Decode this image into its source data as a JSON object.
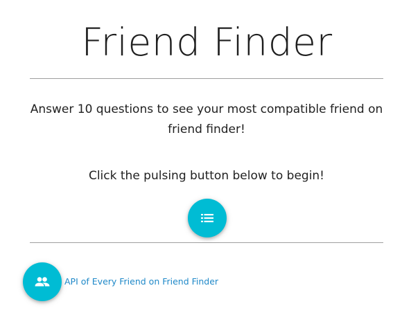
{
  "header": {
    "title": "Friend Finder"
  },
  "main": {
    "intro_text": "Answer 10 questions to see your most compatible friend on friend finder!",
    "instruction_text": "Click the pulsing button below to begin!",
    "start_button_icon": "list-icon"
  },
  "footer": {
    "api_button_icon": "people-icon",
    "api_link_label": "API of Every Friend on Friend Finder"
  },
  "colors": {
    "fab_background": "#00bcd4",
    "link": "#1e88c8",
    "divider": "#9e9e9e"
  }
}
